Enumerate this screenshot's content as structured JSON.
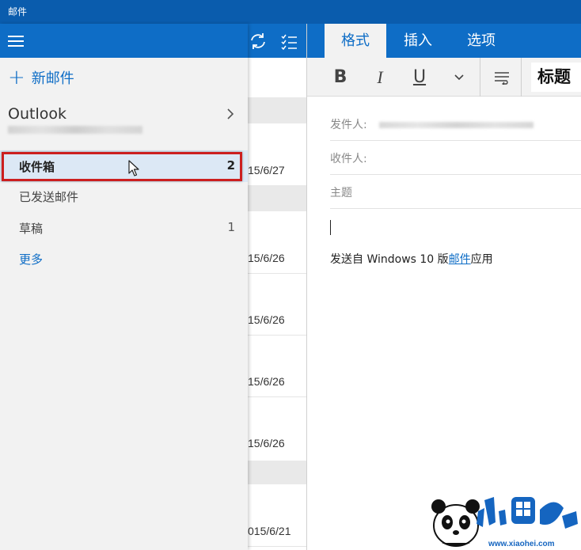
{
  "window": {
    "title": "邮件"
  },
  "nav": {
    "new_mail": "新邮件",
    "account": {
      "name": "Outlook"
    },
    "folders": [
      {
        "name": "收件箱",
        "count": "2"
      },
      {
        "name": "已发送邮件",
        "count": ""
      },
      {
        "name": "草稿",
        "count": "1"
      }
    ],
    "more": "更多"
  },
  "list": {
    "dates": [
      "15/6/27",
      "15/6/26",
      "15/6/26",
      "15/6/26",
      "15/6/26",
      "015/6/21"
    ]
  },
  "compose": {
    "tabs": [
      "格式",
      "插入",
      "选项"
    ],
    "active_tab": "格式",
    "format": {
      "bold": "B",
      "italic": "I",
      "underline": "U",
      "style": "标题"
    },
    "fields": {
      "from_label": "发件人:",
      "to_label": "收件人:",
      "subject_placeholder": "主题"
    },
    "signature": {
      "prefix": "发送自 Windows 10 版",
      "link": "邮件",
      "suffix": "应用"
    }
  },
  "watermark": {
    "text": "小黑游戏",
    "url": "www.xiaohei.com"
  },
  "colors": {
    "accent": "#0e6dc6",
    "titlebar": "#0a5cad",
    "highlight_box": "#cc1f1f",
    "selected_folder": "#dce8f5"
  }
}
